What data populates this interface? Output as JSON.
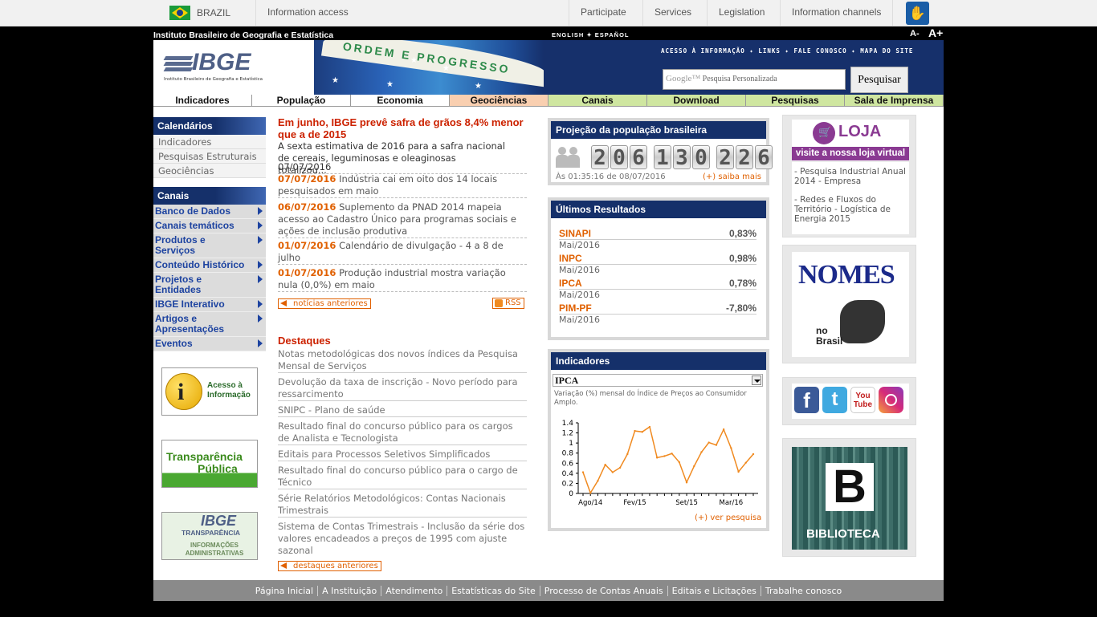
{
  "govbar": {
    "country": "BRAZIL",
    "info_access": "Information access",
    "items": [
      "Participate",
      "Services",
      "Legislation",
      "Information channels"
    ]
  },
  "header": {
    "institute": "Instituto Brasileiro de Geografia e Estatística",
    "languages": "ENGLISH ✦ ESPAÑOL",
    "font_minus": "A-",
    "font_plus": "A+",
    "logo_text": "IBGE",
    "logo_sub": "Instituto Brasileiro de Geografia e Estatística",
    "motto": "ORDEM E PROGRESSO",
    "top_links": "ACESSO À INFORMAÇÃO ✦ LINKS ✦ FALE CONOSCO ✦ MAPA DO SITE",
    "search_placeholder": "Pesquisa Personalizada",
    "search_google": "Google™",
    "search_button": "Pesquisar"
  },
  "nav": [
    {
      "label": "Indicadores",
      "bg": "#ffffff"
    },
    {
      "label": "População",
      "bg": "#ffffff"
    },
    {
      "label": "Economia",
      "bg": "#ffffff"
    },
    {
      "label": "Geociências",
      "bg": "#f9cfb0"
    },
    {
      "label": "Canais",
      "bg": "#cfe6a0"
    },
    {
      "label": "Download",
      "bg": "#cfe6a0"
    },
    {
      "label": "Pesquisas",
      "bg": "#cfe6a0"
    },
    {
      "label": "Sala de Imprensa",
      "bg": "#cfe6a0"
    }
  ],
  "sidebar": {
    "calendarios_title": "Calendários",
    "calendarios": [
      "Indicadores",
      "Pesquisas Estruturais",
      "Geociências"
    ],
    "canais_title": "Canais",
    "canais": [
      "Banco de Dados",
      "Canais temáticos",
      "Produtos e Serviços",
      "Conteúdo Histórico",
      "Projetos e Entidades",
      "IBGE Interativo",
      "Artigos e Apresentações",
      "Eventos"
    ],
    "badge1_text": "Acesso à Informação",
    "badge2_line1": "Transparência",
    "badge2_line2": "Pública",
    "badge3_title": "IBGE",
    "badge3_sub": "TRANSPARÊNCIA",
    "badge3_foot": "INFORMAÇÕES ADMINISTRATIVAS"
  },
  "news": {
    "headline": "Em junho, IBGE prevê safra de grãos 8,4% menor que a de 2015",
    "summary": "A sexta estimativa de 2016 para a safra nacional de cereais, leguminosas e oleaginosas totalizou...",
    "summary_date": "07/07/2016",
    "items": [
      {
        "date": "07/07/2016",
        "text": "Indústria cai em oito dos 14 locais pesquisados em maio"
      },
      {
        "date": "06/07/2016",
        "text": "Suplemento da PNAD 2014 mapeia acesso ao Cadastro Único para programas sociais e ações de inclusão produtiva"
      },
      {
        "date": "01/07/2016",
        "text": "Calendário de divulgação - 4 a 8 de julho"
      },
      {
        "date": "01/07/2016",
        "text": "Produção industrial mostra variação nula (0,0%) em maio"
      }
    ],
    "previous": "notícias anteriores",
    "rss": "RSS"
  },
  "destaques": {
    "title": "Destaques",
    "items": [
      "Notas metodológicas dos novos índices da Pesquisa Mensal de Serviços",
      "Devolução da taxa de inscrição - Novo período para ressarcimento",
      "SNIPC - Plano de saúde",
      "Resultado final do concurso público para os cargos de Analista e Tecnologista",
      "Editais para Processos Seletivos Simplificados",
      "Resultado final do concurso público para o cargo de Técnico",
      "Série Relatórios Metodológicos: Contas Nacionais Trimestrais",
      "Sistema de Contas Trimestrais - Inclusão da série dos valores encadeados a preços de 1995 com ajuste sazonal"
    ],
    "previous": "destaques anteriores"
  },
  "population": {
    "title": "Projeção da população brasileira",
    "digits": [
      "2",
      "0",
      "6",
      "1",
      "3",
      "0",
      "2",
      "2",
      "6"
    ],
    "timestamp": "Às 01:35:16 de 08/07/2016",
    "more": "(+) saiba mais"
  },
  "results": {
    "title": "Últimos Resultados",
    "items": [
      {
        "name": "SINAPI",
        "value": "0,83%",
        "period": "Mai/2016"
      },
      {
        "name": "INPC",
        "value": "0,98%",
        "period": "Mai/2016"
      },
      {
        "name": "IPCA",
        "value": "0,78%",
        "period": "Mai/2016"
      },
      {
        "name": "PIM-PF",
        "value": "-7,80%",
        "period": "Mai/2016"
      }
    ]
  },
  "indicadores": {
    "title": "Indicadores",
    "selected": "IPCA",
    "description": "Variação (%) mensal do Índice de Preços ao Consumidor Amplo.",
    "more": "(+) ver pesquisa"
  },
  "chart_data": {
    "type": "line",
    "title": "",
    "xlabel": "",
    "ylabel": "",
    "ylim": [
      0,
      1.4
    ],
    "yticks": [
      "1.4",
      "1.2",
      "1",
      "0.8",
      "0.6",
      "0.4",
      "0.2",
      "0"
    ],
    "xtick_labels": [
      "Ago/14",
      "Fev/15",
      "Set/15",
      "Mar/16"
    ],
    "xtick_positions": [
      1,
      7,
      14,
      20
    ],
    "values": [
      0.42,
      0.01,
      0.25,
      0.57,
      0.42,
      0.51,
      0.78,
      1.24,
      1.22,
      1.32,
      0.71,
      0.74,
      0.79,
      0.62,
      0.22,
      0.54,
      0.82,
      1.01,
      0.96,
      1.27,
      0.9,
      0.43,
      0.61,
      0.78
    ],
    "line_color": "#f08a20"
  },
  "right": {
    "loja_title": "LOJA",
    "loja_sub": "visite a nossa loja virtual",
    "loja_items": [
      "- Pesquisa Industrial Anual 2014 - Empresa",
      "- Redes e Fluxos do Território - Logística de Energia 2015"
    ],
    "nomes_title": "NOMES",
    "nomes_sub": "no Brasil",
    "social": [
      "f",
      "t",
      "You Tube",
      "ig"
    ],
    "biblioteca_letter": "B",
    "biblioteca": "BIBLIOTECA"
  },
  "footer": [
    "Página Inicial",
    "A Instituição",
    "Atendimento",
    "Estatísticas do Site",
    "Processo de Contas Anuais",
    "Editais e Licitações",
    "Trabalhe conosco"
  ]
}
